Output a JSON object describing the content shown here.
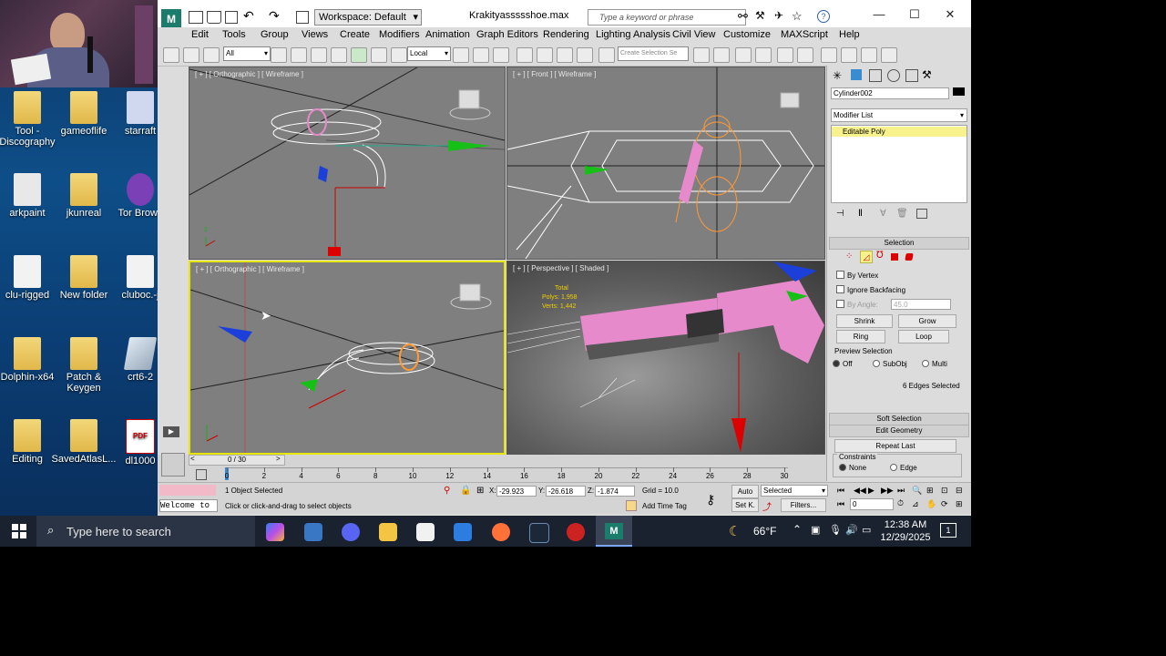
{
  "desktop": {
    "icons": [
      {
        "label": "Tool -\nDiscography",
        "type": "folder"
      },
      {
        "label": "gameoflife",
        "type": "folder"
      },
      {
        "label": "starraft",
        "type": "app"
      },
      {
        "label": "arkpaint",
        "type": "app"
      },
      {
        "label": "jkunreal",
        "type": "folder"
      },
      {
        "label": "Tor Brows",
        "type": "app"
      },
      {
        "label": "clu-rigged",
        "type": "app"
      },
      {
        "label": "New folder",
        "type": "folder"
      },
      {
        "label": "cluboc.-j",
        "type": "doc"
      },
      {
        "label": "Dolphin-x64",
        "type": "folder"
      },
      {
        "label": "Patch &\nKeygen",
        "type": "folder"
      },
      {
        "label": "crt6-2",
        "type": "app"
      },
      {
        "label": "Editing",
        "type": "folder"
      },
      {
        "label": "SavedAtlasL...",
        "type": "folder"
      },
      {
        "label": "dl1000",
        "type": "pdf"
      }
    ]
  },
  "app": {
    "title": "Krakityassssshoe.max",
    "workspace": "Workspace: Default",
    "search_placeholder": "Type a keyword or phrase",
    "menus": [
      "Edit",
      "Tools",
      "Group",
      "Views",
      "Create",
      "Modifiers",
      "Animation",
      "Graph Editors",
      "Rendering",
      "Lighting Analysis",
      "Civil View",
      "Customize",
      "MAXScript",
      "Help"
    ],
    "toolbar": {
      "selection_filter": "All",
      "ref_coord": "Local",
      "named_selection_placeholder": "Create Selection Se"
    },
    "viewports": [
      {
        "label": "[ + ] [ Orthographic ] [ Wireframe ]"
      },
      {
        "label": "[ + ] [ Front ] [ Wireframe ]"
      },
      {
        "label": "[ + ] [ Orthographic ] [ Wireframe ]"
      },
      {
        "label": "[ + ] [ Perspective ] [ Shaded ]"
      }
    ],
    "stats": {
      "total_label": "Total",
      "polys_label": "Polys:",
      "polys": "1,958",
      "verts_label": "Verts:",
      "verts": "1,442"
    },
    "command_panel": {
      "object_name": "Cylinder002",
      "modifier_list": "Modifier List",
      "stack_item": "Editable Poly",
      "selection_header": "Selection",
      "by_vertex": "By Vertex",
      "ignore_backfacing": "Ignore Backfacing",
      "by_angle": "By Angle:",
      "by_angle_value": "45.0",
      "shrink": "Shrink",
      "grow": "Grow",
      "ring": "Ring",
      "loop": "Loop",
      "preview_selection": "Preview Selection",
      "preview_off": "Off",
      "preview_subobj": "SubObj",
      "preview_multi": "Multi",
      "selected_info": "6 Edges Selected",
      "soft_selection": "Soft Selection",
      "edit_geometry": "Edit Geometry",
      "repeat_last": "Repeat Last",
      "constraints": "Constraints",
      "constraint_none": "None",
      "constraint_edge": "Edge"
    },
    "timeline": {
      "frame_counter": "0 / 30",
      "ticks": [
        "0",
        "2",
        "4",
        "6",
        "8",
        "10",
        "12",
        "14",
        "16",
        "18",
        "20",
        "22",
        "24",
        "26",
        "28",
        "30"
      ]
    },
    "status": {
      "welcome": "Welcome to",
      "objects_selected": "1 Object Selected",
      "prompt": "Click or click-and-drag to select objects",
      "x_label": "X:",
      "x": "-29.923",
      "y_label": "Y:",
      "y": "-26.618",
      "z_label": "Z:",
      "z": "-1.874",
      "grid": "Grid = 10.0",
      "add_time_tag": "Add Time Tag",
      "auto": "Auto",
      "set_key": "Set K.",
      "key_filter": "Selected",
      "filters": "Filters...",
      "current_frame": "0"
    }
  },
  "taskbar": {
    "search_placeholder": "Type here to search",
    "weather": "66°F",
    "time": "12:38 AM",
    "date": "12/29/2025",
    "notification_count": "1"
  },
  "colors": {
    "desktop_bg": "#0e4e88",
    "viewport_bg": "#7f7f7f",
    "active_viewport_border": "#e6e600",
    "wire_white": "#ffffff",
    "highlight_pink": "#e78acb",
    "orange_mesh": "#ff9a33",
    "taskbar": "#1a2230"
  }
}
